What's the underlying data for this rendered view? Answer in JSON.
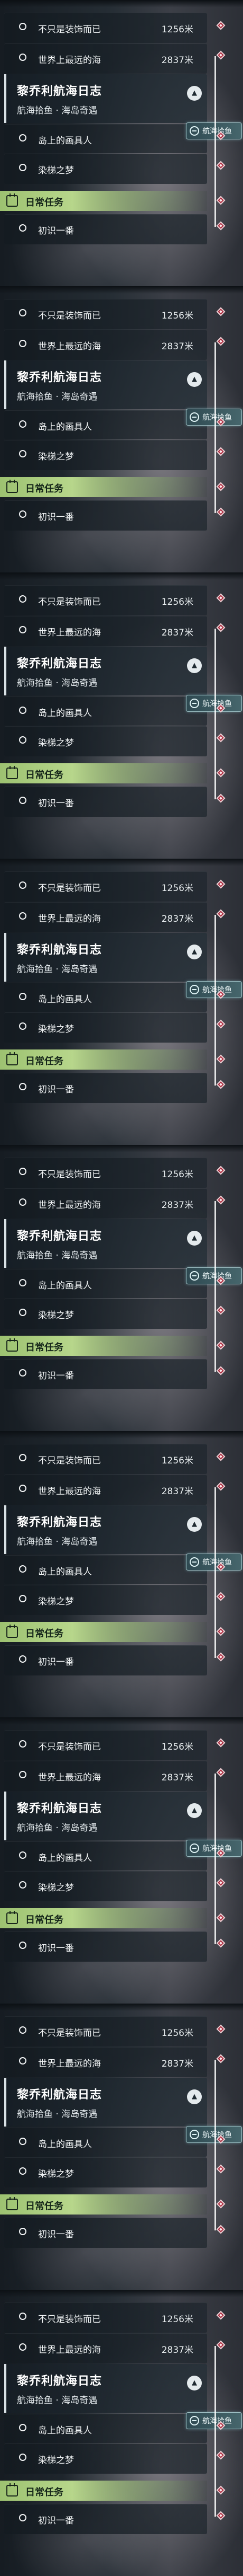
{
  "frames": [
    {
      "completed_tasks": [
        {
          "label": "不只是装饰而已",
          "distance": "1256米"
        },
        {
          "label": "世界上最远的海",
          "distance": "2837米"
        }
      ],
      "quest": {
        "title": "黎乔利航海日志",
        "subtitle": "航海拾鱼 · 海岛奇遇"
      },
      "tag": "航海拾鱼",
      "quest_tasks": [
        "岛上的画具人",
        "染梯之梦"
      ],
      "daily_label": "日常任务",
      "daily_tasks": [
        "初识一番"
      ]
    },
    {
      "completed_tasks": [
        {
          "label": "不只是装饰而已",
          "distance": "1256米"
        },
        {
          "label": "世界上最远的海",
          "distance": "2837米"
        }
      ],
      "quest": {
        "title": "黎乔利航海日志",
        "subtitle": "航海拾鱼 · 海岛奇遇"
      },
      "tag": "航海拾鱼",
      "quest_tasks": [
        "岛上的画具人",
        "染梯之梦"
      ],
      "daily_label": "日常任务",
      "daily_tasks": [
        "初识一番"
      ]
    },
    {
      "completed_tasks": [
        {
          "label": "不只是装饰而已",
          "distance": "1256米"
        },
        {
          "label": "世界上最远的海",
          "distance": "2837米"
        }
      ],
      "quest": {
        "title": "黎乔利航海日志",
        "subtitle": "航海拾鱼 · 海岛奇遇"
      },
      "tag": "航海拾鱼",
      "quest_tasks": [
        "岛上的画具人",
        "染梯之梦"
      ],
      "daily_label": "日常任务",
      "daily_tasks": [
        "初识一番"
      ]
    },
    {
      "completed_tasks": [
        {
          "label": "不只是装饰而已",
          "distance": "1256米"
        },
        {
          "label": "世界上最远的海",
          "distance": "2837米"
        }
      ],
      "quest": {
        "title": "黎乔利航海日志",
        "subtitle": "航海拾鱼 · 海岛奇遇"
      },
      "tag": "航海拾鱼",
      "quest_tasks": [
        "岛上的画具人",
        "染梯之梦"
      ],
      "daily_label": "日常任务",
      "daily_tasks": [
        "初识一番"
      ]
    },
    {
      "completed_tasks": [
        {
          "label": "不只是装饰而已",
          "distance": "1256米"
        },
        {
          "label": "世界上最远的海",
          "distance": "2837米"
        }
      ],
      "quest": {
        "title": "黎乔利航海日志",
        "subtitle": "航海拾鱼 · 海岛奇遇"
      },
      "tag": "航海拾鱼",
      "quest_tasks": [
        "岛上的画具人",
        "染梯之梦"
      ],
      "daily_label": "日常任务",
      "daily_tasks": [
        "初识一番"
      ]
    },
    {
      "completed_tasks": [
        {
          "label": "不只是装饰而已",
          "distance": "1256米"
        },
        {
          "label": "世界上最远的海",
          "distance": "2837米"
        }
      ],
      "quest": {
        "title": "黎乔利航海日志",
        "subtitle": "航海拾鱼 · 海岛奇遇"
      },
      "tag": "航海拾鱼",
      "quest_tasks": [
        "岛上的画具人",
        "染梯之梦"
      ],
      "daily_label": "日常任务",
      "daily_tasks": [
        "初识一番"
      ]
    },
    {
      "completed_tasks": [
        {
          "label": "不只是装饰而已",
          "distance": "1256米"
        },
        {
          "label": "世界上最远的海",
          "distance": "2837米"
        }
      ],
      "quest": {
        "title": "黎乔利航海日志",
        "subtitle": "航海拾鱼 · 海岛奇遇"
      },
      "tag": "航海拾鱼",
      "quest_tasks": [
        "岛上的画具人",
        "染梯之梦"
      ],
      "daily_label": "日常任务",
      "daily_tasks": [
        "初识一番"
      ]
    },
    {
      "completed_tasks": [
        {
          "label": "不只是装饰而已",
          "distance": "1256米"
        },
        {
          "label": "世界上最远的海",
          "distance": "2837米"
        }
      ],
      "quest": {
        "title": "黎乔利航海日志",
        "subtitle": "航海拾鱼 · 海岛奇遇"
      },
      "tag": "航海拾鱼",
      "quest_tasks": [
        "岛上的画具人",
        "染梯之梦"
      ],
      "daily_label": "日常任务",
      "daily_tasks": [
        "初识一番"
      ]
    },
    {
      "completed_tasks": [
        {
          "label": "不只是装饰而已",
          "distance": "1256米"
        },
        {
          "label": "世界上最远的海",
          "distance": "2837米"
        }
      ],
      "quest": {
        "title": "黎乔利航海日志",
        "subtitle": "航海拾鱼 · 海岛奇遇"
      },
      "tag": "航海拾鱼",
      "quest_tasks": [
        "岛上的画具人",
        "染梯之梦"
      ],
      "daily_label": "日常任务",
      "daily_tasks": [
        "初识一番"
      ]
    }
  ]
}
